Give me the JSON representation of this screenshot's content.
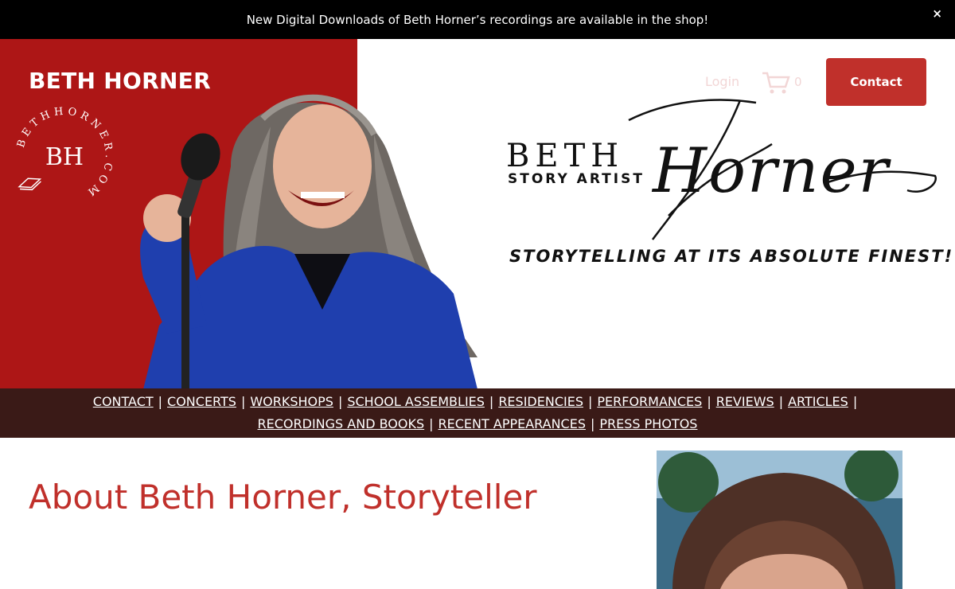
{
  "announcement": {
    "text": "New Digital Downloads of Beth Horner’s recordings are available in the shop!",
    "close_label": "×"
  },
  "header": {
    "site_title": "BETH HORNER",
    "seal_text": "BETHHORNER.COM",
    "seal_monogram": "BH",
    "login_label": "Login",
    "cart_count": "0",
    "contact_label": "Contact"
  },
  "logo": {
    "beth": "BETH",
    "subtitle": "STORY ARTIST",
    "script_name": "Horner",
    "tagline": "STORYTELLING AT ITS ABSOLUTE FINEST!"
  },
  "nav": {
    "items": [
      {
        "label": "CONTACT"
      },
      {
        "label": "CONCERTS"
      },
      {
        "label": "WORKSHOPS"
      },
      {
        "label": "SCHOOL ASSEMBLIES"
      },
      {
        "label": "RESIDENCIES"
      },
      {
        "label": "PERFORMANCES"
      },
      {
        "label": "REVIEWS"
      },
      {
        "label": "ARTICLES"
      },
      {
        "label": "RECORDINGS AND BOOKS"
      },
      {
        "label": "RECENT APPEARANCES"
      },
      {
        "label": "PRESS PHOTOS"
      }
    ],
    "separator": "|"
  },
  "main": {
    "title": "About Beth Horner, Storyteller"
  },
  "icons": {
    "cart": "cart-icon",
    "close": "close-icon",
    "microphone": "microphone-icon"
  },
  "colors": {
    "brand_red": "#ad1616",
    "button_red": "#c0302b",
    "nav_bg": "#3a1a17",
    "announcement_bg": "#000000"
  }
}
